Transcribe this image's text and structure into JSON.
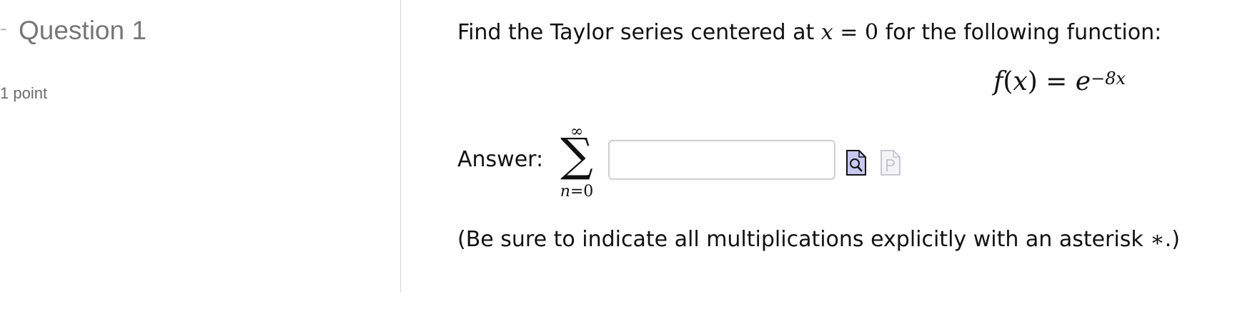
{
  "question": {
    "toggle_symbol": "-",
    "title": "Question 1",
    "points": "1 point"
  },
  "prompt": {
    "text_before": "Find the Taylor series centered at ",
    "math_var": "x",
    "math_eq": " = ",
    "math_val": "0",
    "text_after": " for the following function:"
  },
  "function": {
    "lhs_name": "f",
    "lhs_open": "(",
    "lhs_var": "x",
    "lhs_close": ")",
    "equals": " = ",
    "base": "e",
    "exponent": "−8x"
  },
  "answer": {
    "label": "Answer:",
    "sum_upper": "∞",
    "sum_symbol": "∑",
    "sum_lower_var": "n",
    "sum_lower_rest": "=0",
    "input_value": ""
  },
  "icons": {
    "preview": "preview-icon",
    "format_help": "format-help-icon"
  },
  "note": {
    "text_before": "(Be sure to indicate all multiplications explicitly with an asterisk ",
    "symbol": "∗",
    "text_after": ".)"
  },
  "colors": {
    "heading_gray": "#777777",
    "divider": "#d6d6d6",
    "input_border": "#cfcfcf",
    "preview_icon_fill": "#c8c8f0"
  }
}
